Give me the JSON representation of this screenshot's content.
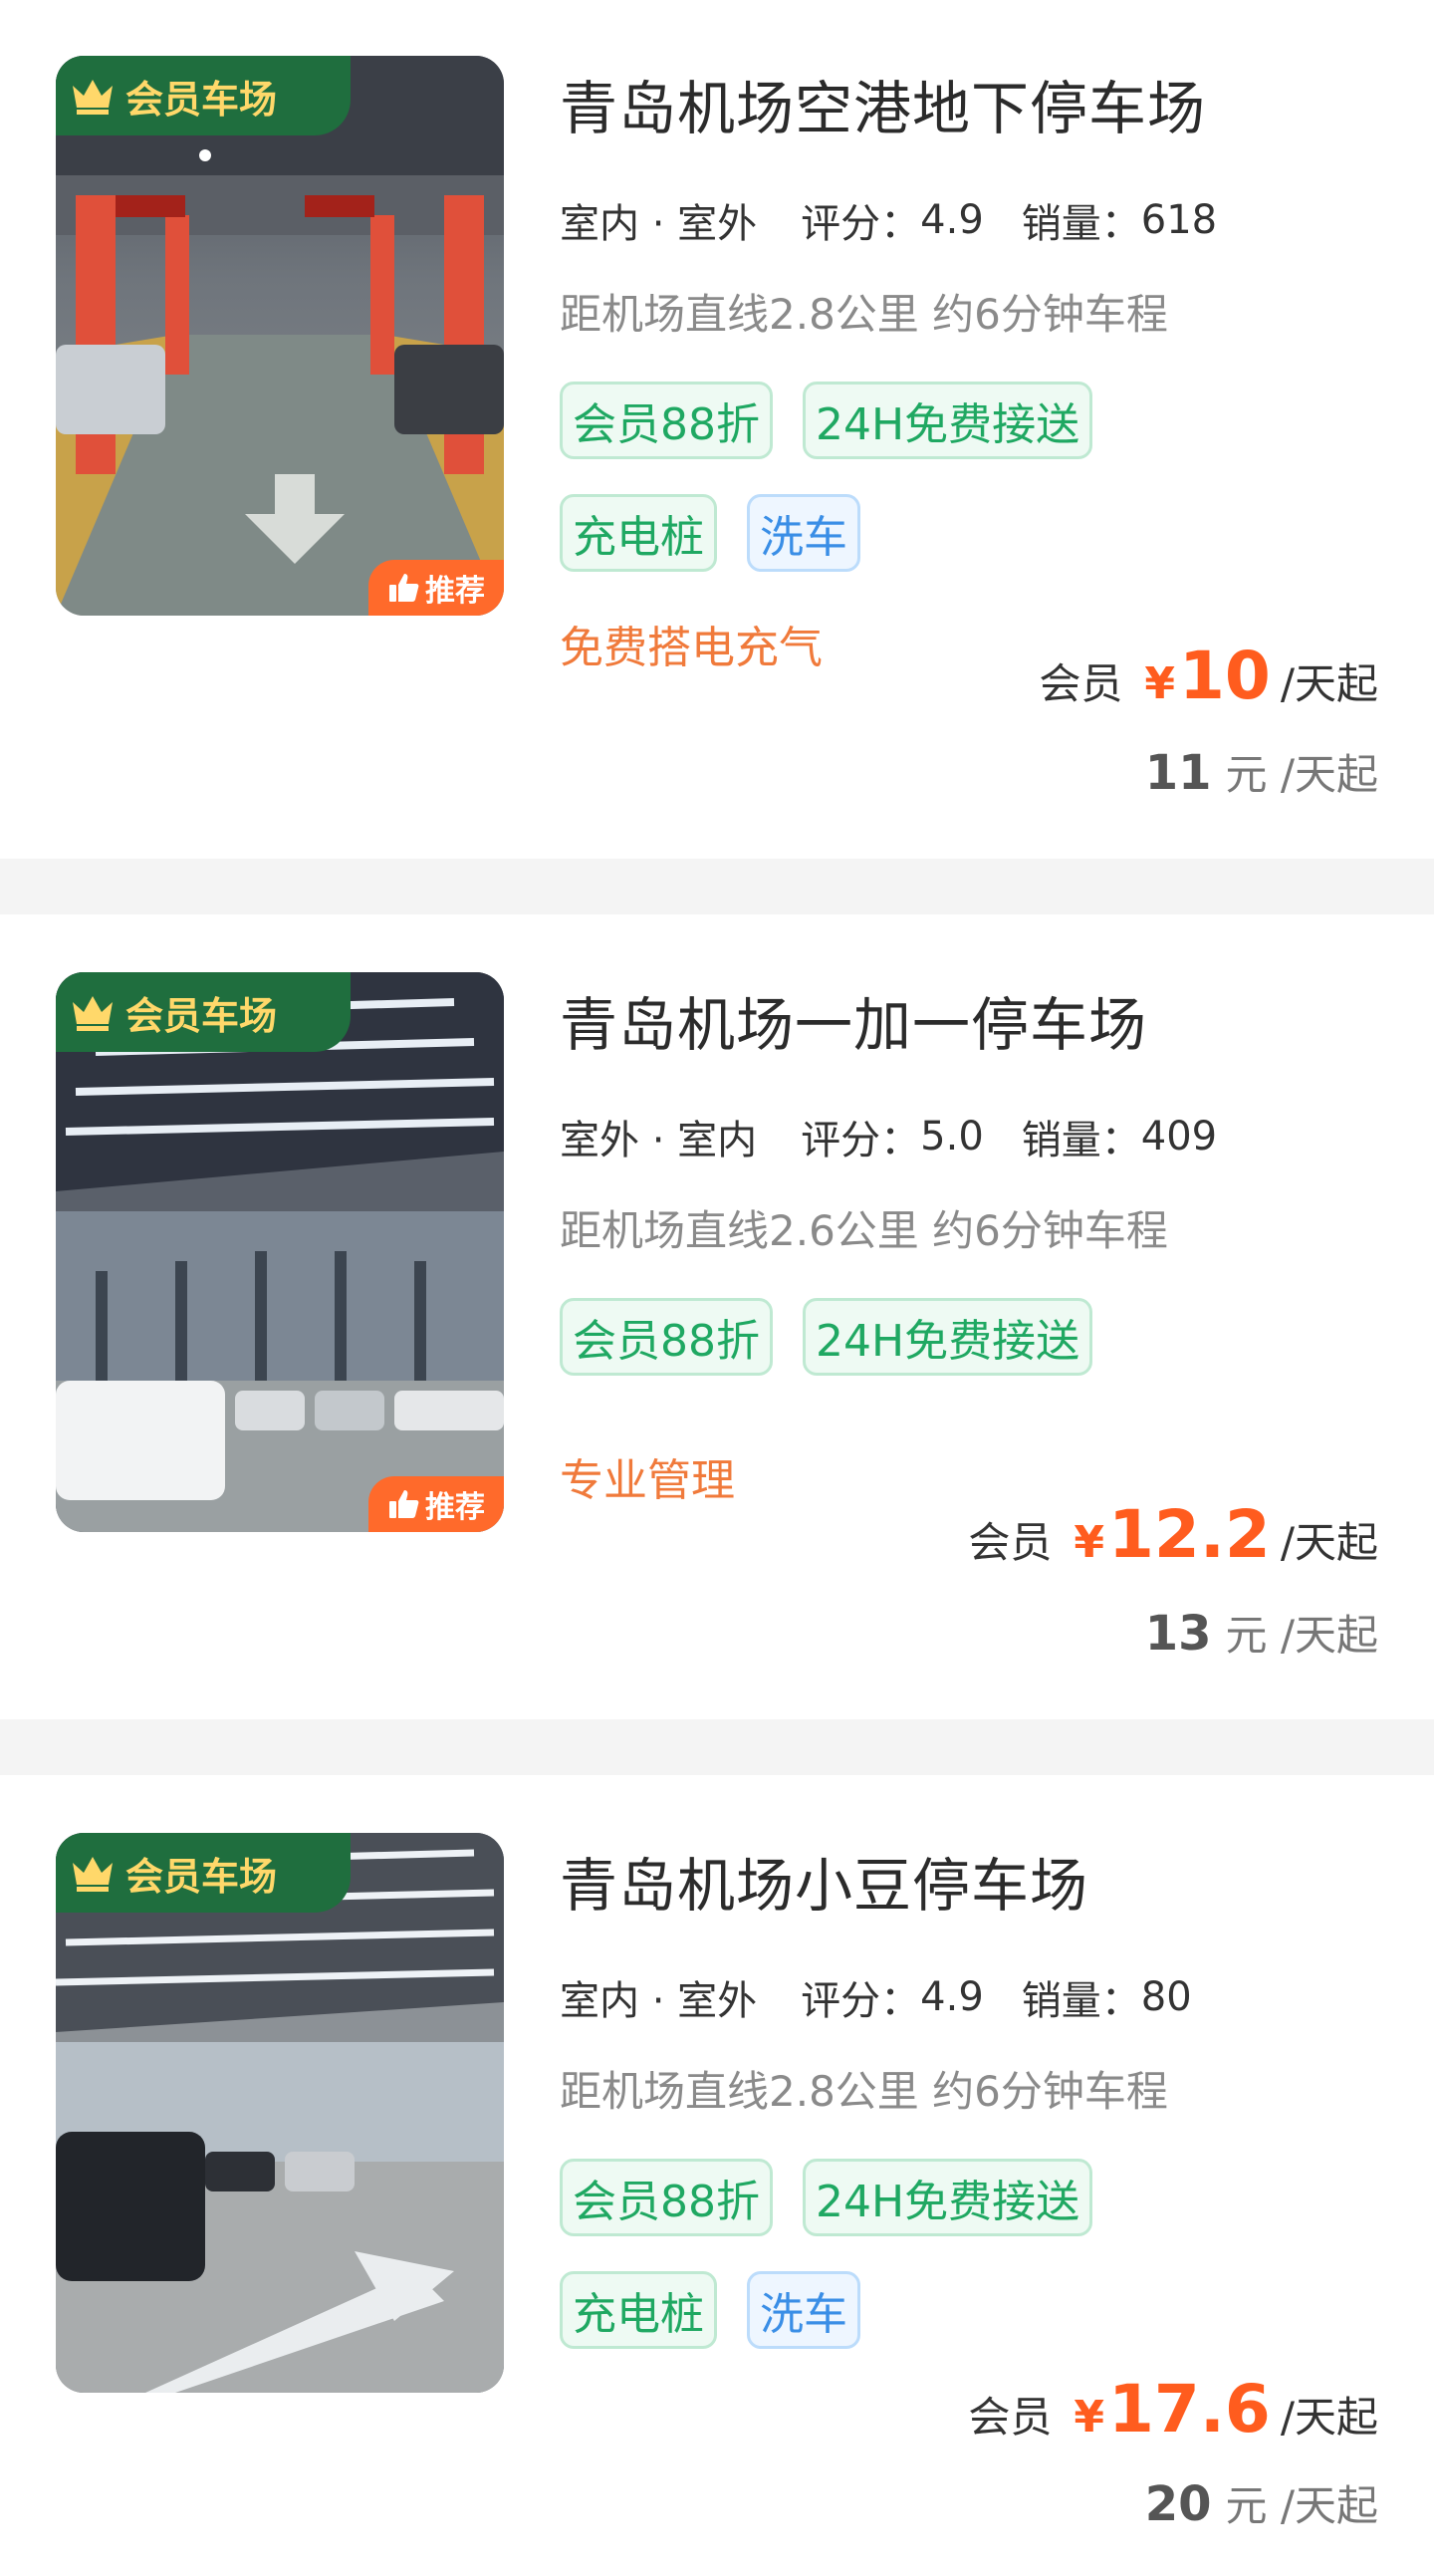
{
  "colors": {
    "member_tag_bg": "#1f6e3e",
    "member_tag_text": "#ffd86a",
    "recommend_bg": "#ff6a2b",
    "price": "#ff5c1e",
    "promo": "#f07a3b",
    "tag_green": "#1fa862",
    "tag_blue": "#3a8ee6"
  },
  "icons": {
    "member_badge": "crown-icon",
    "recommend_badge": "thumbs-up-icon"
  },
  "listings": [
    {
      "member_tag": "会员车场",
      "recommend_tag": "推荐",
      "title": "青岛机场空港地下停车场",
      "type": "室内 · 室外",
      "rating_label": "评分：",
      "rating": "4.9",
      "sales_label": "销量：",
      "sales": "618",
      "distance": "距机场直线2.8公里 约6分钟车程",
      "tags_row1": [
        "会员88折",
        "24H免费接送"
      ],
      "tags_row2": [
        "充电桩",
        "洗车"
      ],
      "promo": "免费搭电充气",
      "member_label": "会员",
      "currency": "¥",
      "member_price": "10",
      "price_unit": "/天起",
      "original_price": "11",
      "original_unit": "元 /天起"
    },
    {
      "member_tag": "会员车场",
      "recommend_tag": "推荐",
      "title": "青岛机场一加一停车场",
      "type": "室外 · 室内",
      "rating_label": "评分：",
      "rating": "5.0",
      "sales_label": "销量：",
      "sales": "409",
      "distance": "距机场直线2.6公里 约6分钟车程",
      "tags_row1": [
        "会员88折",
        "24H免费接送"
      ],
      "promo": "专业管理",
      "member_label": "会员",
      "currency": "¥",
      "member_price": "12.2",
      "price_unit": "/天起",
      "original_price": "13",
      "original_unit": "元 /天起"
    },
    {
      "member_tag": "会员车场",
      "title": "青岛机场小豆停车场",
      "type": "室内 · 室外",
      "rating_label": "评分：",
      "rating": "4.9",
      "sales_label": "销量：",
      "sales": "80",
      "distance": "距机场直线2.8公里 约6分钟车程",
      "tags_row1": [
        "会员88折",
        "24H免费接送"
      ],
      "tags_row2": [
        "充电桩",
        "洗车"
      ],
      "member_label": "会员",
      "currency": "¥",
      "member_price": "17.6",
      "price_unit": "/天起",
      "original_price": "20",
      "original_unit": "元 /天起"
    }
  ]
}
